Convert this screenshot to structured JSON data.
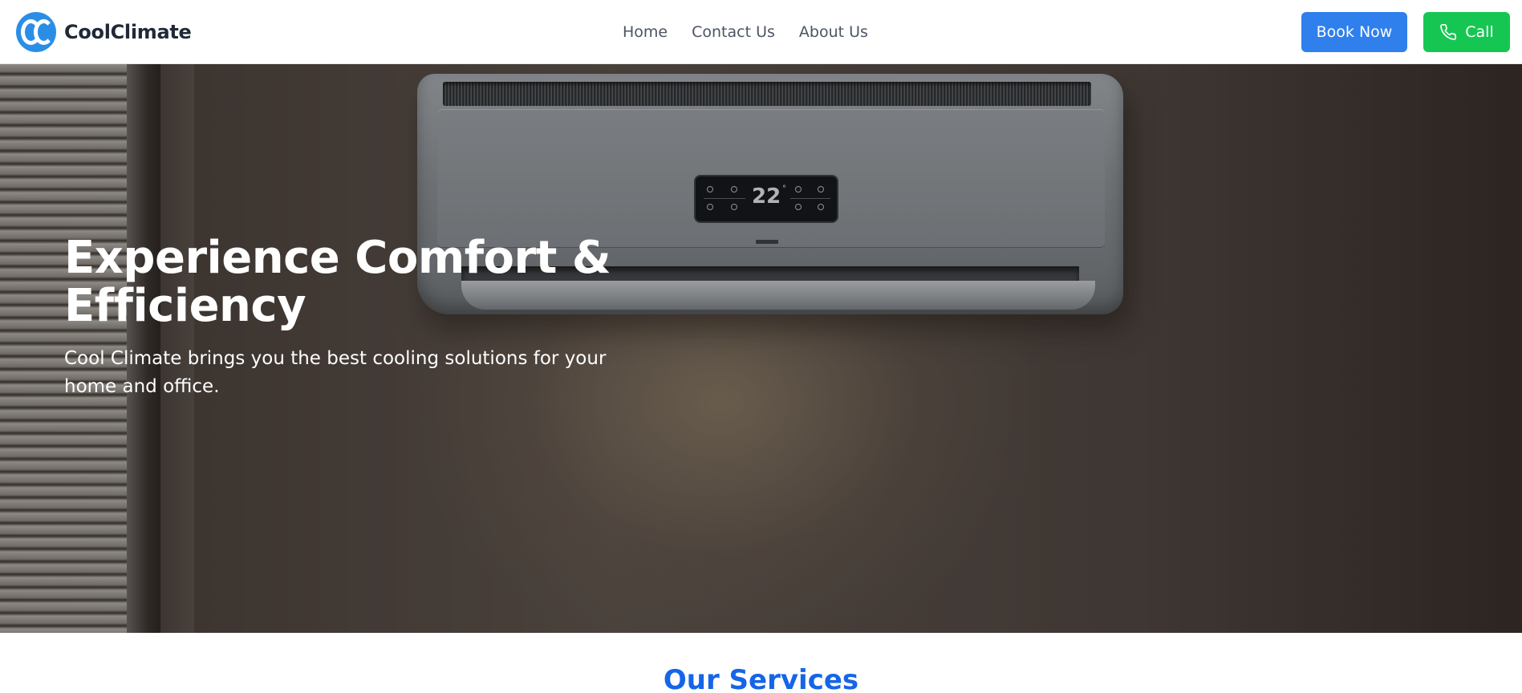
{
  "header": {
    "brand_name": "CoolClimate",
    "nav": [
      {
        "label": "Home"
      },
      {
        "label": "Contact Us"
      },
      {
        "label": "About Us"
      }
    ],
    "book_label": "Book Now",
    "call_label": "Call",
    "colors": {
      "book": "#2f80ed",
      "call": "#16c653",
      "logo": "#2b8ee6"
    }
  },
  "hero": {
    "title": "Experience Comfort & Efficiency",
    "subtitle": "Cool Climate brings you the best cooling solutions for your home and office.",
    "ac_display_temp": "22",
    "ac_display_unit": "°"
  },
  "services": {
    "title": "Our Services",
    "color": "#1565e8"
  },
  "icons": [
    "logo-icon",
    "phone-icon"
  ]
}
